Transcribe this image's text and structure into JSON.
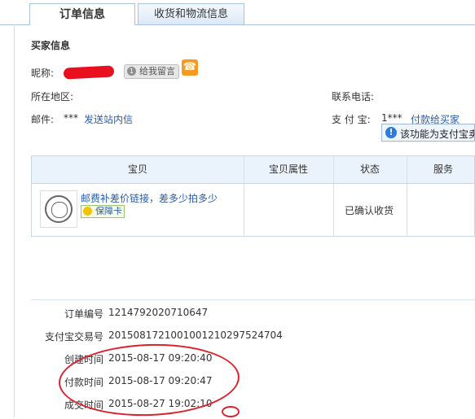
{
  "tabs": [
    {
      "label": "订单信息",
      "active": true
    },
    {
      "label": "收货和物流信息",
      "active": false
    }
  ],
  "buyer": {
    "section_title": "买家信息",
    "nickname_label": "昵称:",
    "leave_message_label": "给我留言",
    "region_label": "所在地区:",
    "email_label": "邮件:",
    "email_value": "***",
    "send_message_link": "发送站内信",
    "contact_label": "联系电话:",
    "alipay_label": "支 付 宝:",
    "alipay_value": "1***",
    "pay_to_buyer_link": "付款给买家",
    "tip_text": "该功能为支付宝卖"
  },
  "items_table": {
    "headers": [
      "宝贝",
      "宝贝属性",
      "状态",
      "服务"
    ],
    "rows": [
      {
        "title": "邮费补差价链接，差多少拍多少",
        "badge": "保障卡",
        "attributes": "",
        "status": "已确认收货",
        "service": ""
      }
    ]
  },
  "order_info": [
    {
      "label": "订单编号",
      "value": "1214792020710647"
    },
    {
      "label": "支付宝交易号",
      "value": "2015081721001001210297524704"
    },
    {
      "label": "创建时间",
      "value": "2015-08-17 09:20:40"
    },
    {
      "label": "付款时间",
      "value": "2015-08-17 09:20:47"
    },
    {
      "label": "成交时间",
      "value": "2015-08-27 19:02:10"
    }
  ],
  "colors": {
    "link": "#2a5caa",
    "annotation_red": "#d9232d",
    "header_bg": "#eaf2fb",
    "phone_orange": "#f59b23"
  }
}
